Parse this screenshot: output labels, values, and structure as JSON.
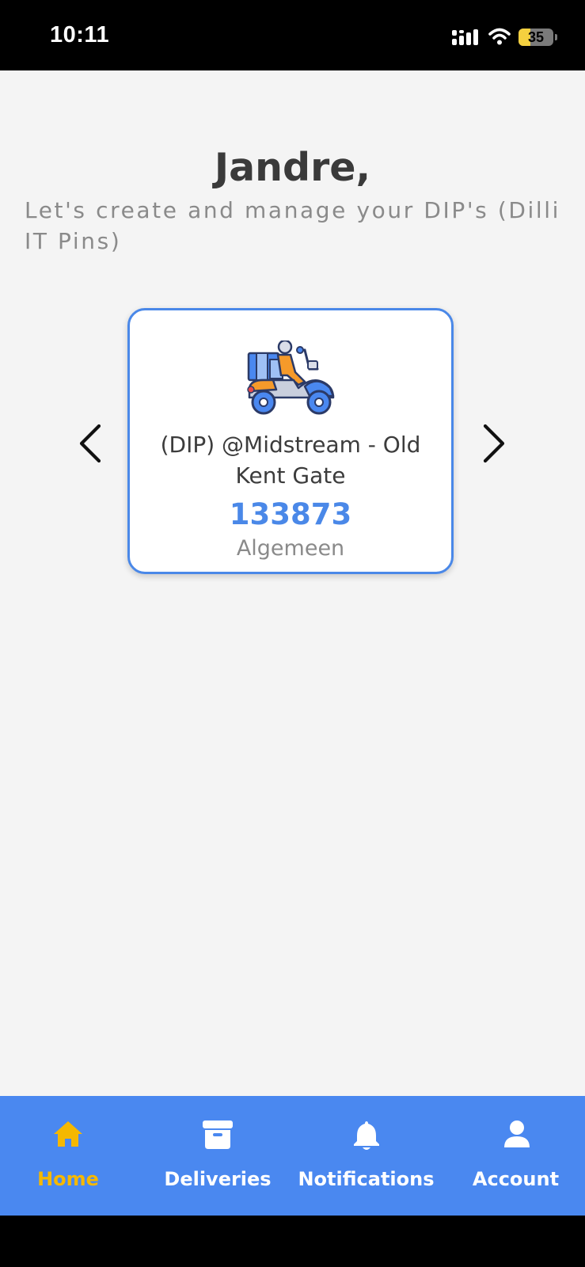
{
  "status_bar": {
    "time": "10:11",
    "battery_percent": "35",
    "battery_level": 0.35,
    "icons": [
      "signal-icon",
      "wifi-icon",
      "battery-icon"
    ]
  },
  "header": {
    "greeting": "Jandre,",
    "subtitle": "Let's create and manage your DIP's (Dilli IT Pins)"
  },
  "carousel": {
    "prev_icon": "chevron-left-icon",
    "next_icon": "chevron-right-icon",
    "card": {
      "icon": "delivery-scooter-icon",
      "title": "(DIP) @Midstream - Old Kent Gate",
      "pin": "133873",
      "category": "Algemeen"
    }
  },
  "bottom_nav": {
    "items": [
      {
        "label": "Home",
        "icon": "home-icon",
        "active": true
      },
      {
        "label": "Deliveries",
        "icon": "archive-box-icon",
        "active": false
      },
      {
        "label": "Notifications",
        "icon": "bell-icon",
        "active": false
      },
      {
        "label": "Account",
        "icon": "user-icon",
        "active": false
      }
    ]
  },
  "colors": {
    "accent": "#4a88f0",
    "active_nav": "#f5b800",
    "background": "#f4f4f4",
    "pin": "#4a88e8"
  }
}
